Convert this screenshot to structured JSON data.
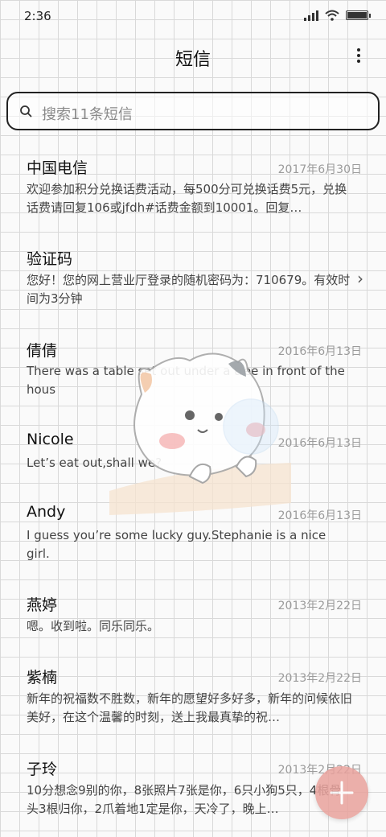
{
  "status_bar": {
    "time": "2:36"
  },
  "header": {
    "title": "短信"
  },
  "search": {
    "placeholder": "搜索11条短信"
  },
  "messages": [
    {
      "name": "中国电信",
      "date": "2017年6月30日",
      "preview": "欢迎参加积分兑换话费活动，每500分可兑换话费5元，兑换话费请回复106或jfdh#话费金额到10001。回复…"
    },
    {
      "name": "验证码",
      "date": "",
      "preview": "您好！您的网上营业厅登录的随机密码为：710679。有效时间为3分钟"
    },
    {
      "name": "倩倩",
      "date": "2016年6月13日",
      "preview": "There was a table set out under a tree in front of the hous"
    },
    {
      "name": "Nicole",
      "date": "2016年6月13日",
      "preview": "Let’s eat out,shall we?"
    },
    {
      "name": "Andy",
      "date": "2016年6月13日",
      "preview": "I guess you’re some lucky guy.Stephanie is a nice girl."
    },
    {
      "name": "燕婷",
      "date": "2013年2月22日",
      "preview": "嗯。收到啦。同乐同乐。"
    },
    {
      "name": "紫楠",
      "date": "2013年2月22日",
      "preview": "新年的祝福数不胜数，新年的愿望好多好多，新年的问候依旧美好，在这个温馨的时刻，送上我最真挚的祝…"
    },
    {
      "name": "子玲",
      "date": "2013年2月22日",
      "preview": "10分想念9别的你，8张照片7张是你，6只小狗5只，4根骨头3根归你，2爪着地1定是你，天冷了，晚上…"
    }
  ],
  "icons": {
    "search": "search-icon",
    "more": "more-vertical-icon",
    "chevron": "chevron-right-icon",
    "fab": "plus-icon"
  },
  "colors": {
    "fab": "#e9a29d",
    "grid": "#d9d9d9"
  }
}
